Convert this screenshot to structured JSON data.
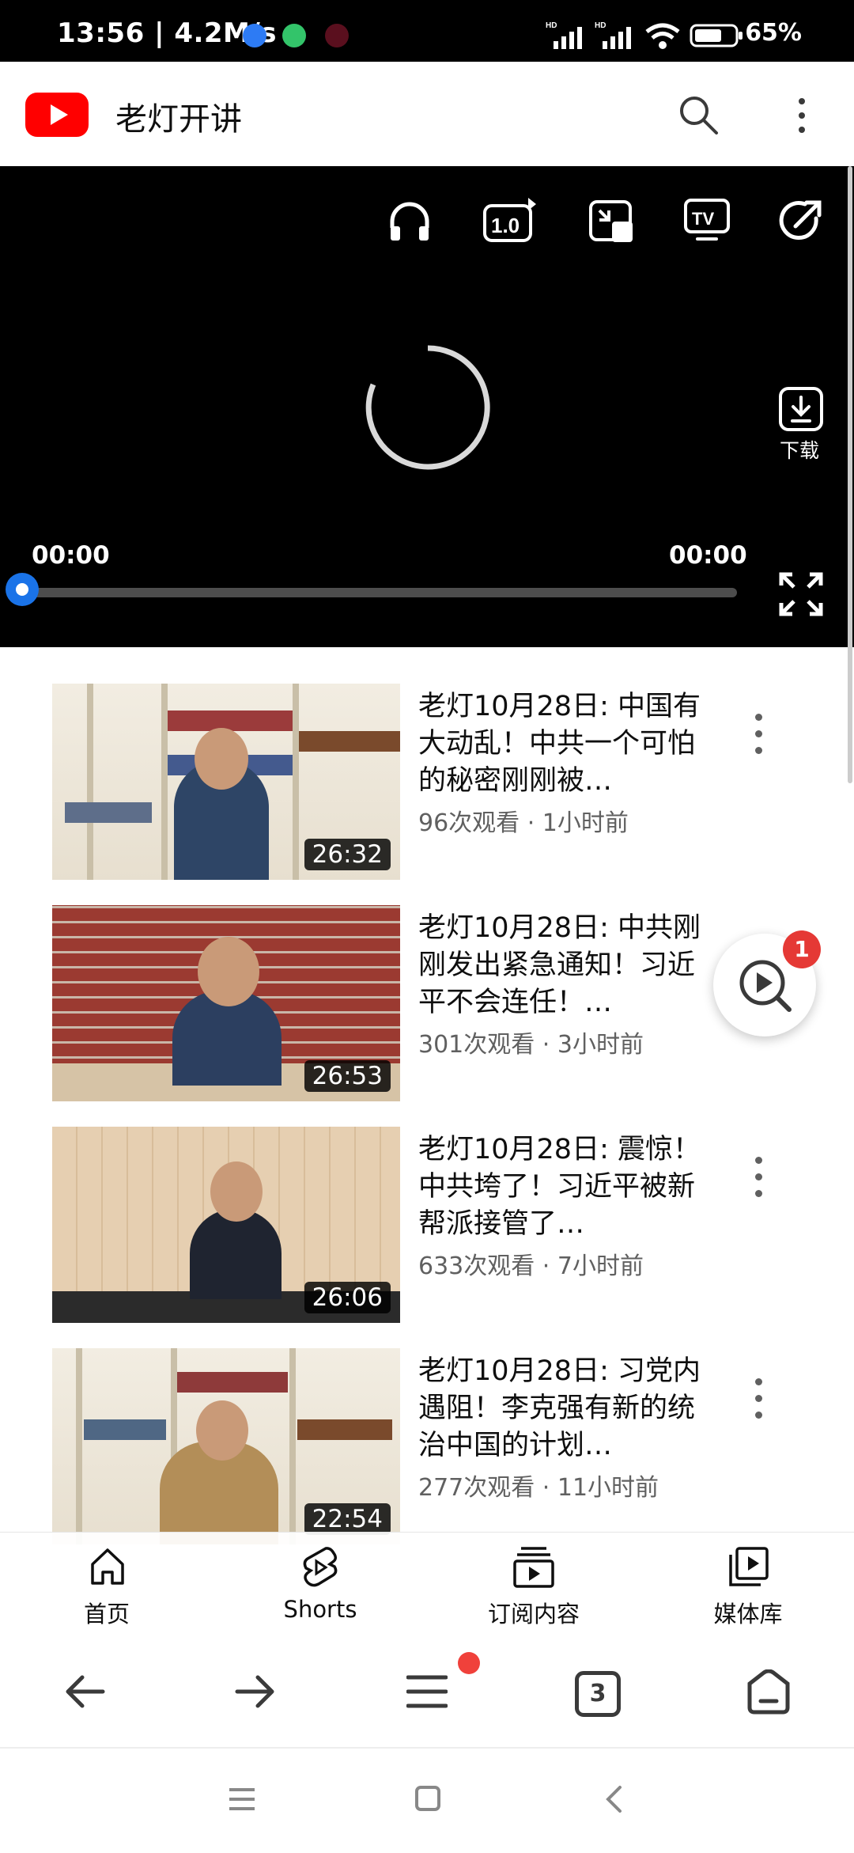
{
  "status_bar": {
    "time": "13:56 | 4.2M/s",
    "battery": "65%",
    "icons": [
      "kuaishou-icon",
      "browser-icon",
      "app-icon",
      "hd-signal-icon",
      "hd-signal-icon",
      "wifi-icon",
      "battery-icon"
    ]
  },
  "header": {
    "title": "老灯开讲",
    "icons": [
      "youtube-logo",
      "search-icon",
      "more-vert-icon"
    ]
  },
  "player": {
    "current_time": "00:00",
    "total_time": "00:00",
    "download_label": "下载",
    "progress": 0,
    "top_icons": [
      "headphones-icon",
      "playback-speed-icon",
      "pip-icon",
      "cast-tv-icon",
      "share-icon"
    ]
  },
  "videos": [
    {
      "title": "老灯10月28日: 中国有大动乱！中共一个可怕的秘密刚刚被…",
      "meta": "96次观看 · 1小时前",
      "duration": "26:32"
    },
    {
      "title": "老灯10月28日: 中共刚刚发出紧急通知！习近平不会连任！…",
      "meta": "301次观看 · 3小时前",
      "duration": "26:53"
    },
    {
      "title": "老灯10月28日: 震惊！中共垮了！习近平被新帮派接管了…",
      "meta": "633次观看 · 7小时前",
      "duration": "26:06"
    },
    {
      "title": "老灯10月28日: 习党内遇阻！李克强有新的统治中国的计划…",
      "meta": "277次观看 · 11小时前",
      "duration": "22:54"
    }
  ],
  "floating_button": {
    "badge": "1"
  },
  "tabs": [
    {
      "label": "首页"
    },
    {
      "label": "Shorts"
    },
    {
      "label": "订阅内容"
    },
    {
      "label": "媒体库"
    }
  ],
  "browser_bar": {
    "tab_count": "3"
  },
  "colors": {
    "brand_red": "#FF0000",
    "progress_blue": "#1A73E8",
    "badge_red": "#E53935"
  }
}
